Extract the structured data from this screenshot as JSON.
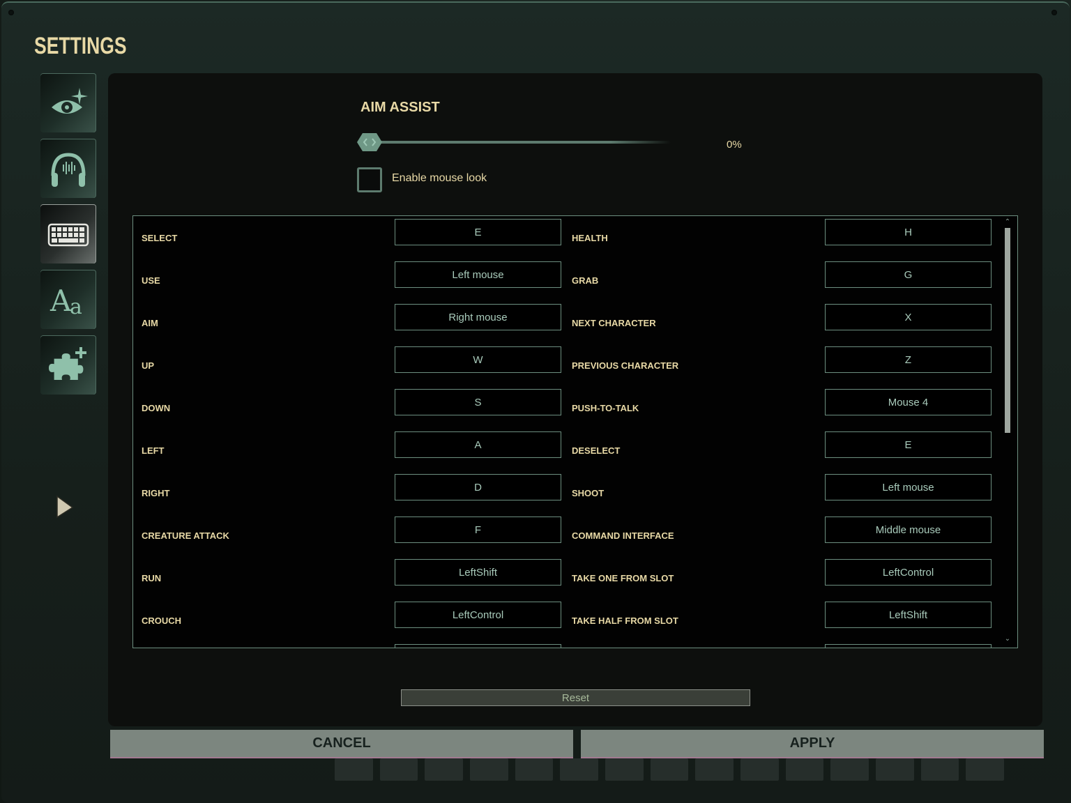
{
  "header": {
    "title": "SETTINGS"
  },
  "sidebar": {
    "tabs": [
      {
        "name": "graphics",
        "icon": "eye-sparkle-icon",
        "active": false
      },
      {
        "name": "audio",
        "icon": "headphones-icon",
        "active": false
      },
      {
        "name": "controls",
        "icon": "keyboard-icon",
        "active": true
      },
      {
        "name": "language",
        "icon": "font-icon",
        "active": false
      },
      {
        "name": "mods",
        "icon": "puzzle-plus-icon",
        "active": false
      }
    ]
  },
  "aim_assist": {
    "title": "AIM ASSIST",
    "value": 0,
    "value_label": "0%",
    "mouse_look": {
      "label": "Enable mouse look",
      "checked": false
    }
  },
  "bindings": {
    "left": [
      {
        "action": "SELECT",
        "key": "E"
      },
      {
        "action": "USE",
        "key": "Left mouse"
      },
      {
        "action": "AIM",
        "key": "Right mouse"
      },
      {
        "action": "UP",
        "key": "W"
      },
      {
        "action": "DOWN",
        "key": "S"
      },
      {
        "action": "LEFT",
        "key": "A"
      },
      {
        "action": "RIGHT",
        "key": "D"
      },
      {
        "action": "CREATURE ATTACK",
        "key": "F"
      },
      {
        "action": "RUN",
        "key": "LeftShift"
      },
      {
        "action": "CROUCH",
        "key": "LeftControl"
      }
    ],
    "right": [
      {
        "action": "HEALTH",
        "key": "H"
      },
      {
        "action": "GRAB",
        "key": "G"
      },
      {
        "action": "NEXT CHARACTER",
        "key": "X"
      },
      {
        "action": "PREVIOUS CHARACTER",
        "key": "Z"
      },
      {
        "action": "PUSH-TO-TALK",
        "key": "Mouse 4"
      },
      {
        "action": "DESELECT",
        "key": "E"
      },
      {
        "action": "SHOOT",
        "key": "Left mouse"
      },
      {
        "action": "COMMAND INTERFACE",
        "key": "Middle mouse"
      },
      {
        "action": "TAKE ONE FROM SLOT",
        "key": "LeftControl"
      },
      {
        "action": "TAKE HALF FROM SLOT",
        "key": "LeftShift"
      }
    ]
  },
  "buttons": {
    "reset": "Reset",
    "cancel": "CANCEL",
    "apply": "APPLY"
  },
  "colors": {
    "accent": "#6d8f80",
    "title": "#e8d9a6",
    "key_text": "#a9cbbb"
  }
}
